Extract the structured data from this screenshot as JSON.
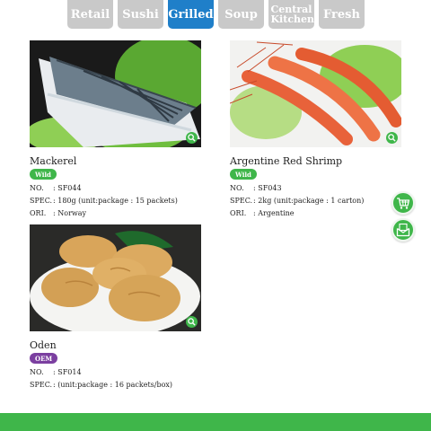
{
  "tabs": [
    {
      "label": "Retail",
      "active": false
    },
    {
      "label": "Sushi",
      "active": false
    },
    {
      "label": "Grilled",
      "active": true
    },
    {
      "label": "Soup",
      "active": false
    },
    {
      "label": "Central Kitchen",
      "active": false
    },
    {
      "label": "Fresh",
      "active": false
    }
  ],
  "labels": {
    "no": "NO.",
    "spec": "SPEC.",
    "ori": "ORI."
  },
  "products": [
    {
      "name": "Mackerel",
      "badge": "Wild",
      "badge_color": "#3fb64a",
      "no": "SF044",
      "spec": "180g (unit:package : 15 packets)",
      "ori": "Norway",
      "photo_icon": "zoom-icon"
    },
    {
      "name": "Argentine Red Shrimp",
      "badge": "Wild",
      "badge_color": "#3fb64a",
      "no": "SF043",
      "spec": "2kg (unit:package : 1 carton)",
      "ori": "Argentine",
      "photo_icon": "zoom-icon"
    },
    {
      "name": "Oden",
      "badge": "OEM",
      "badge_color": "#7b3fa0",
      "no": "SF014",
      "spec": "(unit:package : 16 packets/box)",
      "photo_icon": "zoom-icon"
    }
  ],
  "floating": [
    "cart-icon",
    "mail-icon"
  ],
  "colors": {
    "accent_green": "#3fb64a",
    "active_tab": "#1f7fc9",
    "inactive_tab": "#c9c9c9"
  }
}
